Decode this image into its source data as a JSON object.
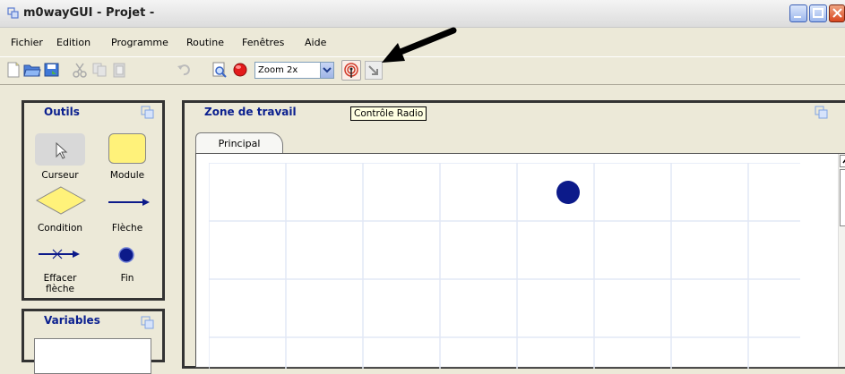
{
  "window": {
    "title": "m0wayGUI - Projet -"
  },
  "menu": [
    "Fichier",
    "Edition",
    "Programme",
    "Routine",
    "Fenêtres",
    "Aide"
  ],
  "toolbar": {
    "zoom_value": "Zoom 2x",
    "tooltip": "Contrôle Radio"
  },
  "tools_panel": {
    "title": "Outils",
    "items": [
      {
        "label": "Curseur",
        "icon": "cursor-icon"
      },
      {
        "label": "Module",
        "icon": "module-icon"
      },
      {
        "label": "Condition",
        "icon": "condition-icon"
      },
      {
        "label": "Flèche",
        "icon": "arrow-icon"
      },
      {
        "label": "Effacer flèche",
        "icon": "erase-arrow-icon"
      },
      {
        "label": "Fin",
        "icon": "end-icon"
      }
    ]
  },
  "variables_panel": {
    "title": "Variables"
  },
  "work_panel": {
    "title": "Zone de travail",
    "tab": "Principal"
  },
  "colors": {
    "panel_title": "#0a1f8f",
    "end_node": "#0c1a8a",
    "module": "#fff27a",
    "condition": "#fff27a"
  }
}
